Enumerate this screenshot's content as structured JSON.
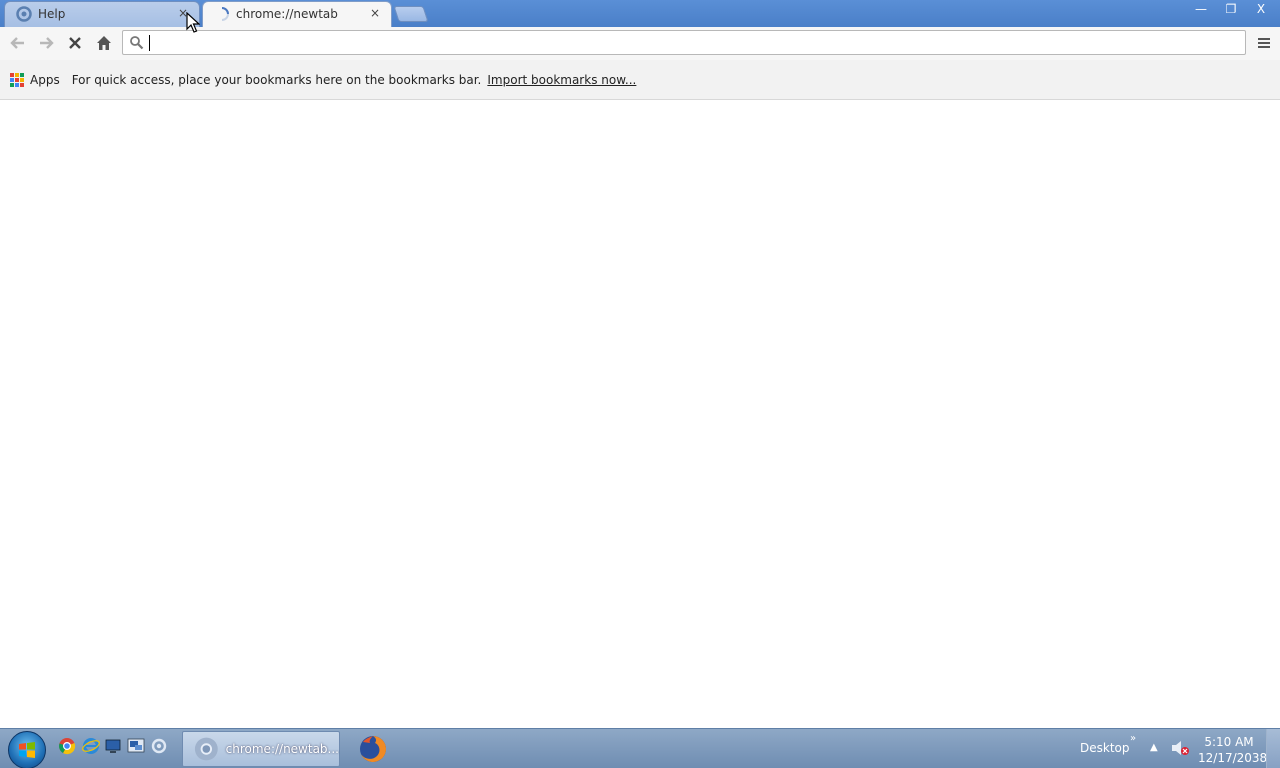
{
  "tabs": [
    {
      "title": "Help",
      "close": "×"
    },
    {
      "title": "chrome://newtab",
      "close": "×"
    }
  ],
  "window_controls": {
    "minimize": "—",
    "restore": "❐",
    "close": "X"
  },
  "omnibox": {
    "value": "",
    "placeholder": ""
  },
  "bookmarks_bar": {
    "apps_label": "Apps",
    "hint": "For quick access, place your bookmarks here on the bookmarks bar.",
    "import_link": "Import bookmarks now..."
  },
  "taskbar": {
    "chrome_task_label": "chrome://newtab...",
    "desktop_label": "Desktop",
    "chevron": "»",
    "tray_arrow": "▲",
    "time": "5:10 AM",
    "date": "12/17/2038"
  },
  "colors": {
    "titlebar": "#4a7fc8",
    "toolbar": "#f6f6f6",
    "bookmarks_bar": "#f2f2f2",
    "taskbar": "#7f9abc"
  },
  "icons": {
    "back": "back-arrow-icon",
    "forward": "forward-arrow-icon",
    "stop": "stop-icon",
    "home": "home-icon",
    "search": "search-icon",
    "star": "star-icon",
    "menu": "menu-icon"
  }
}
